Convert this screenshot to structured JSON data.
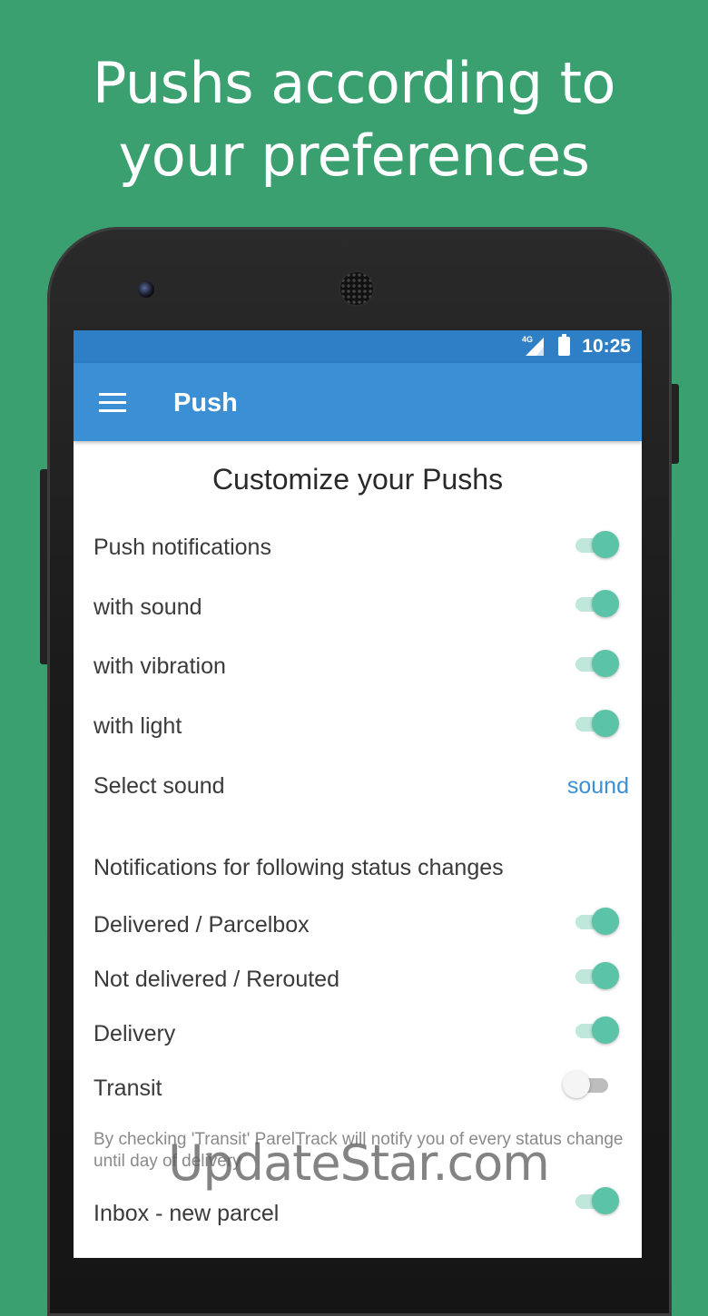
{
  "headline": {
    "line1": "Pushs according to",
    "line2": "your preferences"
  },
  "status_bar": {
    "network": "4G",
    "time": "10:25"
  },
  "app_bar": {
    "title": "Push",
    "menu_icon": "hamburger-menu-icon"
  },
  "main": {
    "section_title": "Customize your Pushs",
    "settings": [
      {
        "label": "Push notifications",
        "enabled": true
      },
      {
        "label": "with sound",
        "enabled": true
      },
      {
        "label": "with vibration",
        "enabled": true
      },
      {
        "label": "with light",
        "enabled": true
      }
    ],
    "select_sound": {
      "label": "Select sound",
      "value": "sound"
    },
    "status_section_title": "Notifications for following status changes",
    "status_changes": [
      {
        "label": "Delivered / Parcelbox",
        "enabled": true
      },
      {
        "label": "Not delivered / Rerouted",
        "enabled": true
      },
      {
        "label": "Delivery",
        "enabled": true
      },
      {
        "label": "Transit",
        "enabled": false
      }
    ],
    "transit_note": "By checking 'Transit' ParelTrack will notify you of every status change until day of delivery",
    "inbox": {
      "label": "Inbox - new parcel",
      "enabled": true
    }
  },
  "watermark": "UpdateStar.com",
  "colors": {
    "background": "#3aa070",
    "app_bar": "#3a8fd5",
    "status_bar": "#2f7fc6",
    "toggle_on": "#5bc4a8",
    "link": "#3a8fd5"
  }
}
